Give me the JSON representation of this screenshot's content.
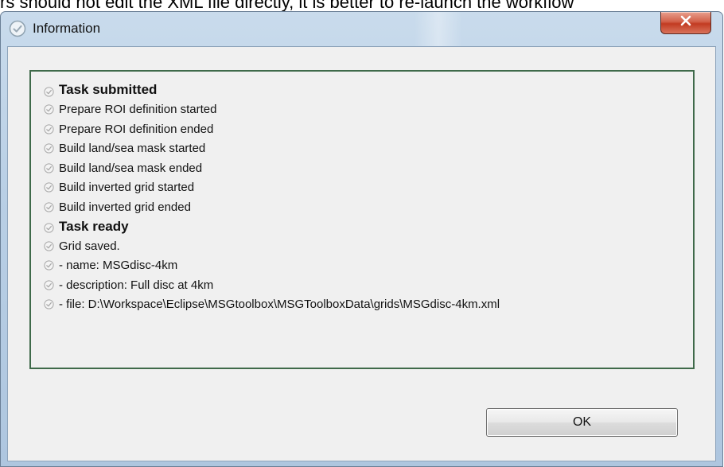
{
  "background": {
    "overlapping_text": "rs should not edit the XML file directly, it is better to re-launch the workflow"
  },
  "dialog": {
    "title": "Information",
    "title_icon": "check-circle-icon",
    "close_icon": "close-icon",
    "log_icon": "check-circle-icon",
    "log": [
      {
        "text": "Task submitted",
        "bold": true
      },
      {
        "text": "Prepare ROI definition started",
        "bold": false
      },
      {
        "text": "Prepare ROI definition ended",
        "bold": false
      },
      {
        "text": "Build land/sea mask started",
        "bold": false
      },
      {
        "text": "Build land/sea mask ended",
        "bold": false
      },
      {
        "text": "Build inverted grid started",
        "bold": false
      },
      {
        "text": "Build inverted grid ended",
        "bold": false
      },
      {
        "text": "Task ready",
        "bold": true
      },
      {
        "text": "Grid saved.",
        "bold": false
      },
      {
        "text": " - name: MSGdisc-4km",
        "bold": false
      },
      {
        "text": " - description: Full disc at 4km",
        "bold": false
      },
      {
        "text": " - file: D:\\Workspace\\Eclipse\\MSGtoolbox\\MSGToolboxData\\grids\\MSGdisc-4km.xml",
        "bold": false
      }
    ],
    "ok_label": "OK"
  },
  "colors": {
    "log_border": "#3f6a4a",
    "close_button": "#c23b22",
    "client_bg": "#f0f0f0"
  }
}
